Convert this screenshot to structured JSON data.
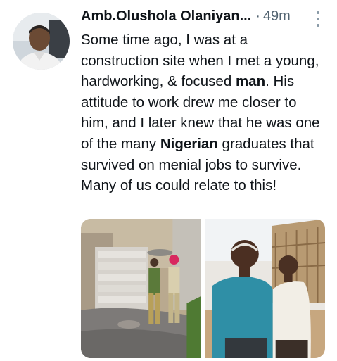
{
  "tweet": {
    "author_name": "Amb.Olushola Olaniyan...",
    "separator": "·",
    "time": "49m",
    "text_parts": [
      "Some time ago, I was at a construction site when I met a young, hardworking, & focused ",
      "man",
      ". His attitude to work drew me closer to him, and I later knew that he was one of the many ",
      "Nigerian",
      " graduates that survived on menial jobs to survive. Many of us could relate to this!"
    ],
    "avatar_icon": "profile-photo",
    "more_icon": "more-options-vertical-icon"
  },
  "media": [
    {
      "icon": "construction-workers-photo"
    },
    {
      "icon": "two-men-smiling-photo"
    }
  ],
  "colors": {
    "text": "#0f1419",
    "muted": "#536471",
    "background": "#ffffff"
  }
}
